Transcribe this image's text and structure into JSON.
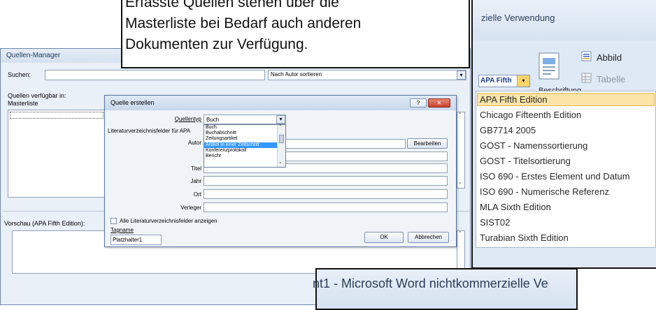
{
  "callout_top": {
    "lines": [
      "Erfasste Quellen stehen über die",
      "Masterliste bei Bedarf auch anderen",
      "Dokumenten zur Verfügung."
    ]
  },
  "callout_bottom": {
    "text": "nt1  -  Microsoft Word nichtkommerzielle Ve"
  },
  "ribbon": {
    "title_fragment": "zielle Verwendung",
    "insert_figure_label": "Abbild",
    "table_label": "Tabelle",
    "caption_label": "Beschriftung",
    "style_selected": "APA Fifth",
    "style_options": [
      "APA Fifth Edition",
      "Chicago Fifteenth Edition",
      "GB7714 2005",
      "GOST - Namenssortierung",
      "GOST - Titelsortierung",
      "ISO 690 - Erstes Element und Datum",
      "ISO 690 - Numerische Referenz",
      "MLA Sixth Edition",
      "SIST02",
      "Turabian Sixth Edition"
    ]
  },
  "source_manager": {
    "title": "Quellen-Manager",
    "search_label": "Suchen:",
    "sort_value": "Nach Autor sortieren",
    "available_label": "Quellen verfügbar in:",
    "masterlist_label": "Masterliste",
    "preview_label": "Vorschau (APA Fifth Edition):"
  },
  "dialog": {
    "title": "Quelle erstellen",
    "help_label": "?",
    "close_label": "✕",
    "source_type_label": "Quellentyp",
    "source_type_value": "Buch",
    "bib_fields_label": "Literaturverzeichnisfelder für APA",
    "author_label": "Autor",
    "title_label": "Titel",
    "year_label": "Jahr",
    "city_label": "Ort",
    "publisher_label": "Verleger",
    "edit_button": "Bearbeiten",
    "source_type_options": [
      "Buch",
      "Buchabschnitt",
      "Zeitungsartikel",
      "Artikel in einer Zeitschrift",
      "Konferenzprotokoll",
      "Bericht"
    ],
    "selected_option_index": 3,
    "show_all_fields_label": "Alle Literaturverzeichnisfelder anzeigen",
    "tag_label": "Tagname",
    "tag_value": "Platzhalter1",
    "ok_button": "OK",
    "cancel_button": "Abbrechen"
  },
  "colors": {
    "selection": "#3399ff",
    "window_bg": "#eaf0f7",
    "ribbon_bg": "#dfe9f5"
  }
}
